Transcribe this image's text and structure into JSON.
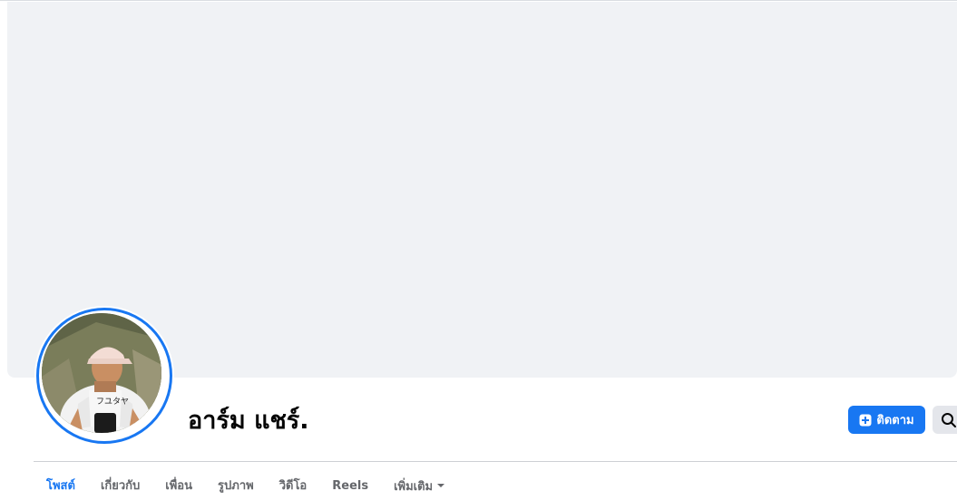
{
  "profile": {
    "name": "อาร์ม แชร์."
  },
  "actions": {
    "follow_label": "ติดตาม",
    "follow_icon": "plus-square-icon",
    "search_icon": "search-icon"
  },
  "tabs": [
    {
      "label": "โพสต์",
      "active": true
    },
    {
      "label": "เกี่ยวกับ",
      "active": false
    },
    {
      "label": "เพื่อน",
      "active": false
    },
    {
      "label": "รูปภาพ",
      "active": false
    },
    {
      "label": "วิดีโอ",
      "active": false
    },
    {
      "label": "Reels",
      "active": false
    },
    {
      "label": "เพิ่มเติม",
      "active": false,
      "icon": "caret-down-icon"
    }
  ],
  "colors": {
    "accent": "#1877f2",
    "cover": "#f0f2f5",
    "secondary_button": "#e4e6eb"
  }
}
